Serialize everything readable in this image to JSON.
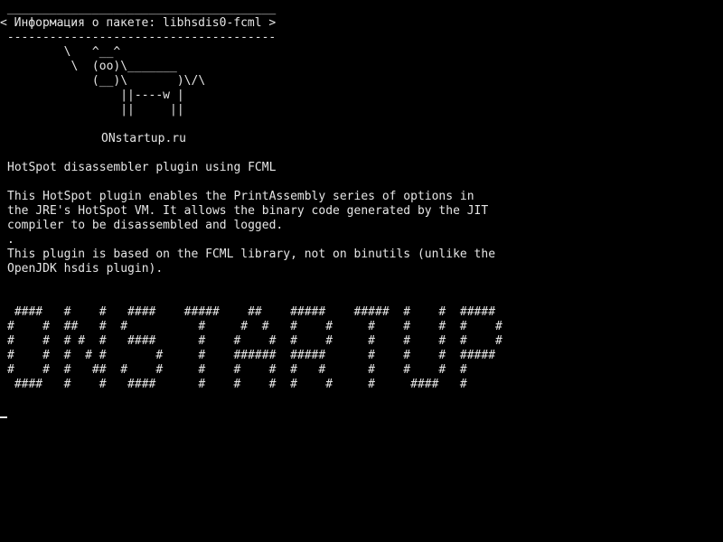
{
  "terminal": {
    "header": {
      "rule_top": " ______________________________________",
      "title": "< Информация о пакете: libhsdis0-fcml >",
      "rule_bottom": " --------------------------------------"
    },
    "cow": [
      "        \\   ^__^",
      "         \\  (oo)\\_______",
      "            (__)\\       )\\/\\",
      "                ||----w |",
      "                ||     ||"
    ],
    "site": "ONstartup.ru",
    "package_title": "HotSpot disassembler plugin using FCML",
    "description": [
      "This HotSpot plugin enables the PrintAssembly series of options in",
      "the JRE's HotSpot VM. It allows the binary code generated by the JIT",
      "compiler to be disassembled and logged.",
      ".",
      "This plugin is based on the FCML library, not on binutils (unlike the",
      "OpenJDK hsdis plugin)."
    ],
    "banner": [
      " ####   #    #   ####    #####    ##    #####    #####  #    #  #####",
      "#    #  ##   #  #          #     #  #   #    #     #    #    #  #    #",
      "#    #  # #  #   ####      #    #    #  #    #     #    #    #  #    #",
      "#    #  #  # #       #     #    ######  #####      #    #    #  #####",
      "#    #  #   ##  #    #     #    #    #  #   #      #    #    #  #",
      " ####   #    #   ####      #    #    #  #    #     #     ####   #"
    ]
  }
}
